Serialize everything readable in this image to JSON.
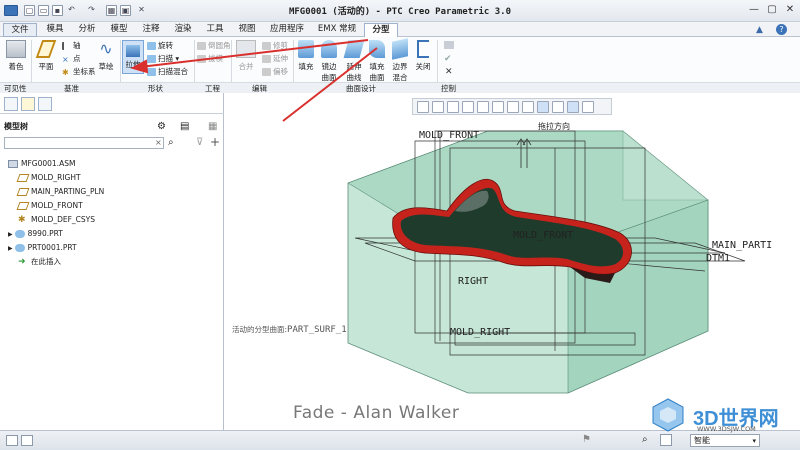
{
  "window": {
    "title": "MFG0001 (活动的) - PTC Creo Parametric 3.0"
  },
  "menu_tabs": [
    "文件",
    "模具",
    "分析",
    "模型",
    "注释",
    "渲染",
    "工具",
    "视图",
    "应用程序",
    "EMX 常规",
    "分型面"
  ],
  "active_tab": "分型面",
  "ribbon": {
    "big": [
      "着色",
      "平面",
      "草绘",
      "填充",
      "镜边曲面",
      "延伸曲线",
      "填充曲面",
      "边界混合",
      "关闭"
    ],
    "datum_small": [
      "轴",
      "点",
      "坐标系"
    ],
    "shape_small": [
      "旋转",
      "扫描",
      "扫描混合",
      "拉伸"
    ],
    "eng_small": [
      "倒圆角",
      "拔模"
    ],
    "edit_small": [
      "修剪",
      "延伸",
      "偏移",
      "合并"
    ],
    "groups": [
      "可见性",
      "基准",
      "形状",
      "工程",
      "编辑",
      "曲面设计",
      "控制"
    ]
  },
  "panel": {
    "title": "模型树",
    "items": [
      "MFG0001.ASM",
      "MOLD_RIGHT",
      "MAIN_PARTING_PLN",
      "MOLD_FRONT",
      "MOLD_DEF_CSYS",
      "8990.PRT",
      "PRT0001.PRT",
      "在此插入"
    ]
  },
  "viewport": {
    "labels": [
      "MOLD_FRONT",
      "拖拉方向",
      "MOLD_FRONT",
      "MAIN_PARTI",
      "DTM1",
      "RIGHT",
      "MOLD_RIGHT"
    ],
    "status_text": "活动的分型曲面:",
    "status_value": "PART_SURF_1"
  },
  "statusbar": {
    "mode": "智能"
  },
  "watermark": {
    "caption": "Fade - Alan Walker",
    "site": "3D世界网",
    "url": "WWW.3DSJW.COM"
  },
  "colors": {
    "ribbon_accent": "#3874b8",
    "arrow": "#d9302e",
    "mold_box": "#7fc3a6",
    "part_red": "#c7231d"
  }
}
